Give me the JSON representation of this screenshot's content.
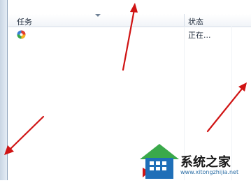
{
  "task_list": {
    "columns": {
      "task": "任务",
      "status": "状态"
    },
    "rows": [
      {
        "icon": "colorful-pinwheel-icon",
        "name": "",
        "status": "正在..."
      }
    ]
  },
  "watermark": {
    "title": "系统之家",
    "url": "www.xitongzhijia.net"
  },
  "colors": {
    "arrow": "#d01414",
    "frame": "#c9d6e4",
    "header_text": "#1e2a3a",
    "watermark_blue": "#1f6fb8",
    "watermark_green": "#3aa94a"
  }
}
